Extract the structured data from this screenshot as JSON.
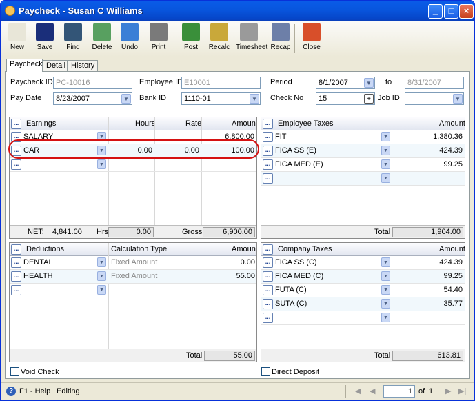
{
  "window": {
    "title": "Paycheck - Susan C Williams",
    "min": "_",
    "max": "□",
    "close": "×"
  },
  "toolbar": [
    {
      "label": "New",
      "icon": "new-icon",
      "color": "#e8e6d8"
    },
    {
      "label": "Save",
      "icon": "save-icon",
      "color": "#1a2e7a"
    },
    {
      "label": "Find",
      "icon": "find-icon",
      "color": "#335577"
    },
    {
      "label": "Delete",
      "icon": "delete-icon",
      "color": "#58a060"
    },
    {
      "label": "Undo",
      "icon": "undo-icon",
      "color": "#3b7fd6"
    },
    {
      "label": "Print",
      "icon": "print-icon",
      "color": "#7a7a7a"
    },
    {
      "label": "Post",
      "icon": "post-icon",
      "color": "#3a8f3a"
    },
    {
      "label": "Recalc",
      "icon": "recalc-icon",
      "color": "#c9a83a"
    },
    {
      "label": "Timesheet",
      "icon": "timesheet-icon",
      "color": "#9a9a9a"
    },
    {
      "label": "Recap",
      "icon": "recap-icon",
      "color": "#6d7fa8"
    },
    {
      "label": "Close",
      "icon": "close-icon",
      "color": "#d84f2a"
    }
  ],
  "tabs": [
    "Paycheck",
    "Detail",
    "History"
  ],
  "header": {
    "paycheck_id_label": "Paycheck ID",
    "paycheck_id": "PC-10016",
    "employee_id_label": "Employee ID",
    "employee_id": "E10001",
    "period_label": "Period",
    "period_from": "8/1/2007",
    "to_label": "to",
    "period_to": "8/31/2007",
    "pay_date_label": "Pay Date",
    "pay_date": "8/23/2007",
    "bank_id_label": "Bank ID",
    "bank_id": "1110-01",
    "check_no_label": "Check No",
    "check_no": "15",
    "job_id_label": "Job ID",
    "job_id": ""
  },
  "earnings": {
    "columns": [
      "Earnings",
      "Hours",
      "Rate",
      "Amount"
    ],
    "rows": [
      {
        "name": "SALARY",
        "hours": "",
        "rate": "",
        "amount": "6,800.00"
      },
      {
        "name": "CAR",
        "hours": "0.00",
        "rate": "0.00",
        "amount": "100.00"
      }
    ],
    "net_label": "NET:",
    "net": "4,841.00",
    "hrs_label": "Hrs",
    "hrs": "0.00",
    "gross_label": "Gross",
    "gross": "6,900.00"
  },
  "employee_taxes": {
    "columns": [
      "Employee Taxes",
      "Amount"
    ],
    "rows": [
      {
        "name": "FIT",
        "amount": "1,380.36"
      },
      {
        "name": "FICA SS (E)",
        "amount": "424.39"
      },
      {
        "name": "FICA MED (E)",
        "amount": "99.25"
      }
    ],
    "total_label": "Total",
    "total": "1,904.00"
  },
  "deductions": {
    "columns": [
      "Deductions",
      "Calculation Type",
      "Amount"
    ],
    "rows": [
      {
        "name": "DENTAL",
        "calc": "Fixed Amount",
        "amount": "0.00"
      },
      {
        "name": "HEALTH",
        "calc": "Fixed Amount",
        "amount": "55.00"
      }
    ],
    "total_label": "Total",
    "total": "55.00"
  },
  "company_taxes": {
    "columns": [
      "Company Taxes",
      "Amount"
    ],
    "rows": [
      {
        "name": "FICA SS (C)",
        "amount": "424.39"
      },
      {
        "name": "FICA MED (C)",
        "amount": "99.25"
      },
      {
        "name": "FUTA (C)",
        "amount": "54.40"
      },
      {
        "name": "SUTA (C)",
        "amount": "35.77"
      }
    ],
    "total_label": "Total",
    "total": "613.81"
  },
  "checks": {
    "void_check": "Void Check",
    "direct_deposit": "Direct Deposit"
  },
  "status": {
    "help": "F1 - Help",
    "state": "Editing",
    "page": "1",
    "of": "of",
    "pages": "1"
  }
}
